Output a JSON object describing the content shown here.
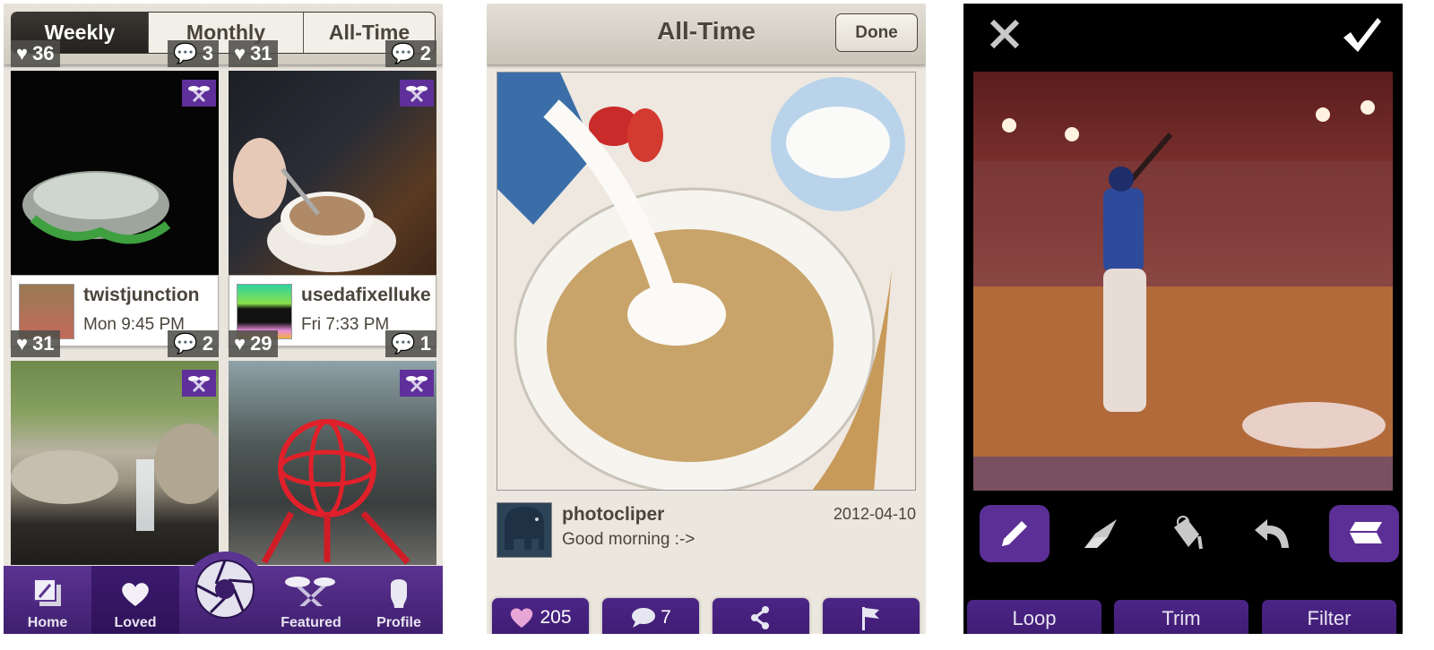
{
  "screen1": {
    "segments": [
      {
        "label": "Weekly",
        "active": true
      },
      {
        "label": "Monthly",
        "active": false
      },
      {
        "label": "All-Time",
        "active": false
      }
    ],
    "posts": [
      {
        "likes": "36",
        "comments": "3",
        "username": "twistjunction",
        "time": "Mon 9:45 PM",
        "photo": "jellyfish",
        "featured_badge": "featured-icon"
      },
      {
        "likes": "31",
        "comments": "2",
        "username": "usedafixelluke",
        "time": "Fri 7:33 PM",
        "photo": "latte",
        "featured_badge": "featured-icon"
      },
      {
        "likes": "31",
        "comments": "2",
        "photo": "waterfall",
        "featured_badge": "featured-icon"
      },
      {
        "likes": "29",
        "comments": "1",
        "photo": "red-sphere-sculpture",
        "featured_badge": "featured-icon"
      }
    ],
    "tabbar": {
      "items": [
        {
          "label": "Home",
          "icon": "home-icon",
          "active": false
        },
        {
          "label": "Loved",
          "icon": "heart-icon",
          "active": true
        },
        {
          "label": "",
          "icon": "camera-shutter-icon",
          "active": false
        },
        {
          "label": "Featured",
          "icon": "featured-icon",
          "active": false
        },
        {
          "label": "Profile",
          "icon": "profile-icon",
          "active": false
        }
      ]
    }
  },
  "screen2": {
    "title": "All-Time",
    "done_label": "Done",
    "post": {
      "username": "photocliper",
      "caption": "Good morning :->",
      "date": "2012-04-10",
      "photo": "cereal-with-milk"
    },
    "actions": [
      {
        "icon": "heart-icon",
        "label": "205"
      },
      {
        "icon": "comment-icon",
        "label": "7"
      },
      {
        "icon": "share-icon",
        "label": ""
      },
      {
        "icon": "flag-icon",
        "label": ""
      }
    ]
  },
  "screen3": {
    "close_icon": "close-icon",
    "confirm_icon": "checkmark-icon",
    "video": "baseball-batter",
    "tools": [
      {
        "icon": "pencil-icon",
        "selected": true
      },
      {
        "icon": "eraser-icon",
        "selected": false
      },
      {
        "icon": "paint-bucket-icon",
        "selected": false
      },
      {
        "icon": "undo-icon",
        "selected": false
      },
      {
        "icon": "layers-icon",
        "selected": true
      }
    ],
    "bottom_buttons": [
      {
        "label": "Loop"
      },
      {
        "label": "Trim"
      },
      {
        "label": "Filter"
      }
    ],
    "colors": {
      "accent": "#5b2f95",
      "button": "#4b2586"
    }
  }
}
